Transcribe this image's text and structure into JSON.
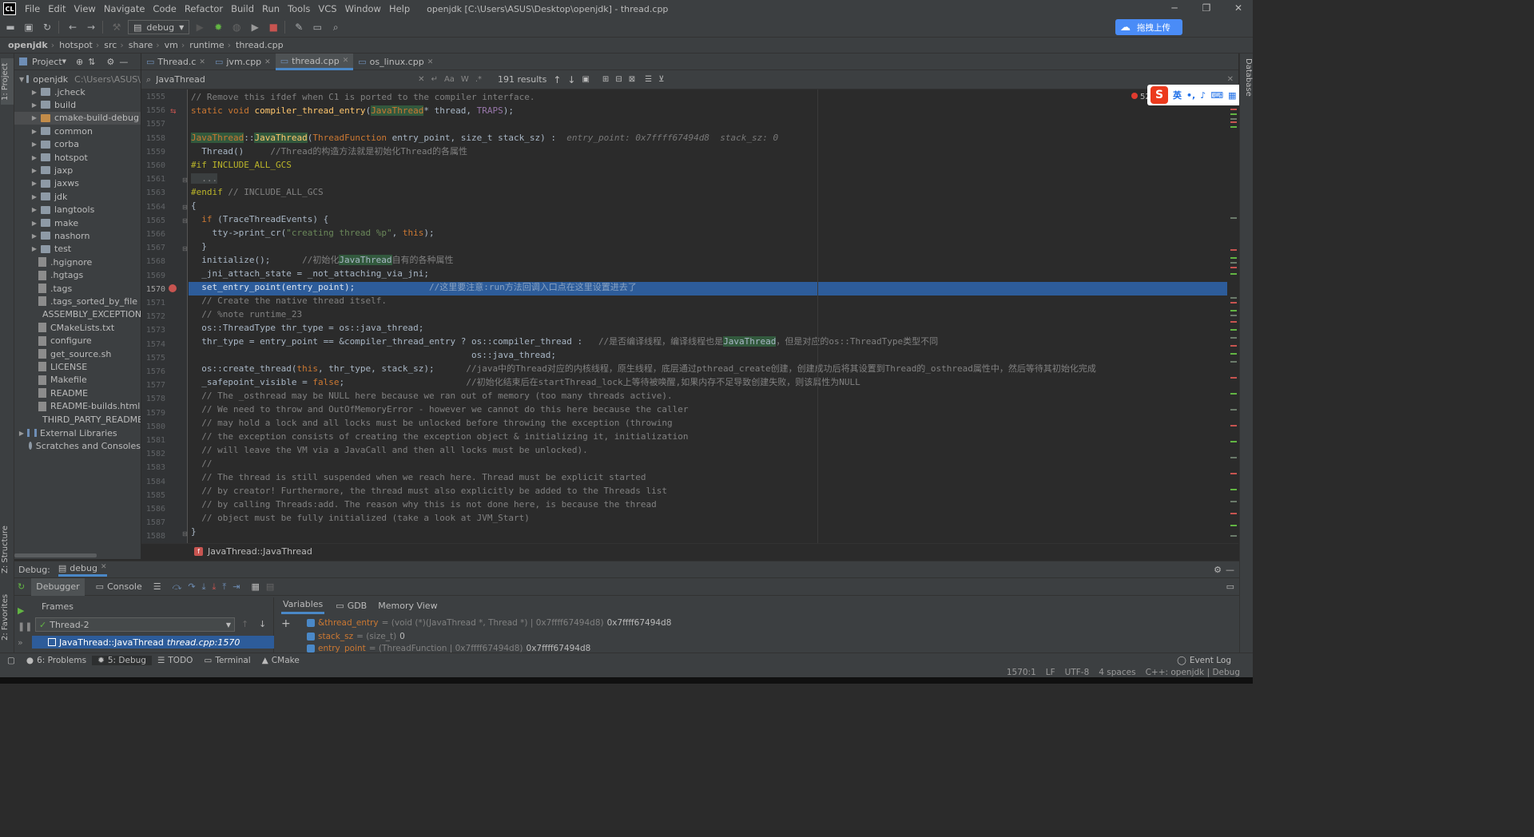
{
  "window": {
    "title": "openjdk [C:\\Users\\ASUS\\Desktop\\openjdk] - thread.cpp",
    "app_icon": "CL"
  },
  "menu": [
    "File",
    "Edit",
    "View",
    "Navigate",
    "Code",
    "Refactor",
    "Build",
    "Run",
    "Tools",
    "VCS",
    "Window",
    "Help"
  ],
  "toolbar": {
    "run_config": "debug",
    "cloud_button": "拖拽上传"
  },
  "nav": [
    "openjdk",
    "hotspot",
    "src",
    "share",
    "vm",
    "runtime",
    "thread.cpp"
  ],
  "project": {
    "title": "Project",
    "root": "openjdk",
    "root_path": "C:\\Users\\ASUS\\",
    "items": [
      {
        "label": ".jcheck",
        "kind": "folder"
      },
      {
        "label": "build",
        "kind": "folder"
      },
      {
        "label": "cmake-build-debug",
        "kind": "folder-orange"
      },
      {
        "label": "common",
        "kind": "folder"
      },
      {
        "label": "corba",
        "kind": "folder"
      },
      {
        "label": "hotspot",
        "kind": "folder"
      },
      {
        "label": "jaxp",
        "kind": "folder"
      },
      {
        "label": "jaxws",
        "kind": "folder"
      },
      {
        "label": "jdk",
        "kind": "folder"
      },
      {
        "label": "langtools",
        "kind": "folder"
      },
      {
        "label": "make",
        "kind": "folder"
      },
      {
        "label": "nashorn",
        "kind": "folder"
      },
      {
        "label": "test",
        "kind": "folder"
      },
      {
        "label": ".hgignore",
        "kind": "file"
      },
      {
        "label": ".hgtags",
        "kind": "file"
      },
      {
        "label": ".tags",
        "kind": "file"
      },
      {
        "label": ".tags_sorted_by_file",
        "kind": "file"
      },
      {
        "label": "ASSEMBLY_EXCEPTION",
        "kind": "file"
      },
      {
        "label": "CMakeLists.txt",
        "kind": "file"
      },
      {
        "label": "configure",
        "kind": "file"
      },
      {
        "label": "get_source.sh",
        "kind": "file"
      },
      {
        "label": "LICENSE",
        "kind": "file"
      },
      {
        "label": "Makefile",
        "kind": "file"
      },
      {
        "label": "README",
        "kind": "file"
      },
      {
        "label": "README-builds.html",
        "kind": "file"
      },
      {
        "label": "THIRD_PARTY_README",
        "kind": "file"
      }
    ],
    "external": "External Libraries",
    "scratches": "Scratches and Consoles"
  },
  "tabs": [
    "Thread.c",
    "jvm.cpp",
    "thread.cpp",
    "os_linux.cpp"
  ],
  "find": {
    "query": "JavaThread",
    "results": "191 results"
  },
  "errors": "52",
  "ime": {
    "lang": "英"
  },
  "editor": {
    "lines": [
      "1555",
      "1556",
      "1557",
      "1558",
      "1559",
      "1560",
      "1561",
      "1563",
      "1564",
      "1565",
      "1566",
      "1567",
      "1568",
      "1569",
      "1570",
      "1571",
      "1572",
      "1573",
      "1574",
      "1575",
      "1576",
      "1577",
      "1578",
      "1579",
      "1580",
      "1581",
      "1582",
      "1583",
      "1584",
      "1585",
      "1586",
      "1587",
      "1588"
    ],
    "code": {
      "l1555": "// Remove this ifdef when C1 is ported to the compiler interface.",
      "l1556a": "static void ",
      "l1556b": "compiler_thread_entry",
      "l1556c": "(",
      "l1556d": "JavaThread",
      "l1556e": "* thread, ",
      "l1556f": "TRAPS",
      "l1556g": ");",
      "l1558a": "JavaThread",
      "l1558b": "::",
      "l1558c": "JavaThread",
      "l1558d": "(",
      "l1558e": "ThreadFunction",
      "l1558f": " entry_point, size_t stack_sz) :  ",
      "l1558g": "entry_point: 0x7ffff67494d8  stack_sz: 0",
      "l1559a": "  Thread()     ",
      "l1559b": "//Thread的构造方法就是初始化Thread的各属性",
      "l1560": "#if INCLUDE_ALL_GCS",
      "l1561": "  ...",
      "l1563a": "#endif",
      "l1563b": " // INCLUDE_ALL_GCS",
      "l1564": "{",
      "l1565a": "  ",
      "l1565b": "if",
      "l1565c": " (TraceThreadEvents) {",
      "l1566a": "    tty->print_cr(",
      "l1566b": "\"creating thread %p\"",
      "l1566c": ", ",
      "l1566d": "this",
      "l1566e": ");",
      "l1567": "  }",
      "l1568a": "  initialize();      ",
      "l1568b": "//初始化",
      "l1568c": "JavaThread",
      "l1568d": "自有的各种属性",
      "l1569": "  _jni_attach_state = _not_attaching_via_jni;",
      "l1570a": "  set_entry_point(entry_point);              ",
      "l1570b": "//这里要注意:run方法回调入口点在这里设置进去了",
      "l1571": "  // Create the native thread itself.",
      "l1572": "  // %note runtime_23",
      "l1573": "  os::ThreadType thr_type = os::java_thread;",
      "l1574a": "  thr_type = entry_point == &compiler_thread_entry ? os::compiler_thread :   ",
      "l1574b": "//是否编译线程，编译线程也是",
      "l1574c": "JavaThread",
      "l1574d": "，但是对应的os::ThreadType类型不同",
      "l1575": "                                                     os::java_thread;",
      "l1576a": "  os::create_thread(",
      "l1576b": "this",
      "l1576c": ", thr_type, stack_sz);      ",
      "l1576d": "//java中的Thread对应的内核线程，原生线程，底层通过pthread_create创建，创建成功后将其设置到Thread的_osthread属性中，然后等待其初始化完成",
      "l1577a": "  _safepoint_visible = ",
      "l1577b": "false",
      "l1577c": ";                       ",
      "l1577d": "//初始化结束后在startThread_lock上等待被唤醒,如果内存不足导致创建失败，则该属性为NULL",
      "l1578": "  // The _osthread may be NULL here because we ran out of memory (too many threads active).",
      "l1579": "  // We need to throw and OutOfMemoryError - however we cannot do this here because the caller",
      "l1580": "  // may hold a lock and all locks must be unlocked before throwing the exception (throwing",
      "l1581": "  // the exception consists of creating the exception object & initializing it, initialization",
      "l1582": "  // will leave the VM via a JavaCall and then all locks must be unlocked).",
      "l1583": "  //",
      "l1584": "  // The thread is still suspended when we reach here. Thread must be explicit started",
      "l1585": "  // by creator! Furthermore, the thread must also explicitly be added to the Threads list",
      "l1586": "  // by calling Threads:add. The reason why this is not done here, is because the thread",
      "l1587": "  // object must be fully initialized (take a look at JVM_Start)",
      "l1588": "}"
    },
    "footer_crumb": "JavaThread::JavaThread",
    "footer_icon": "f"
  },
  "debug": {
    "label": "Debug:",
    "config": "debug",
    "tabs": [
      "Debugger",
      "Console"
    ],
    "frames_label": "Frames",
    "thread": "Thread-2",
    "frame": "JavaThread::JavaThread",
    "frame_loc": "thread.cpp:1570",
    "var_tabs": [
      "Variables",
      "GDB",
      "Memory View"
    ],
    "vars": [
      {
        "name": "&thread_entry",
        "type": "= (void (*)(JavaThread *, Thread *) | 0x7ffff67494d8)",
        "value": "0x7ffff67494d8"
      },
      {
        "name": "stack_sz",
        "type": "= (size_t)",
        "value": "0"
      },
      {
        "name": "entry_point",
        "type": "= (ThreadFunction | 0x7ffff67494d8)",
        "value": "0x7ffff67494d8"
      }
    ]
  },
  "bottom_tabs": [
    "6: Problems",
    "5: Debug",
    "TODO",
    "Terminal",
    "CMake"
  ],
  "event_log": "Event Log",
  "status": {
    "position": "1570:1",
    "line_sep": "LF",
    "encoding": "UTF-8",
    "indent": "4 spaces",
    "context": "C++: openjdk | Debug"
  },
  "left_tabs": [
    "1: Project",
    "Z: Structure",
    "2: Favorites"
  ],
  "right_tabs": [
    "Database"
  ]
}
